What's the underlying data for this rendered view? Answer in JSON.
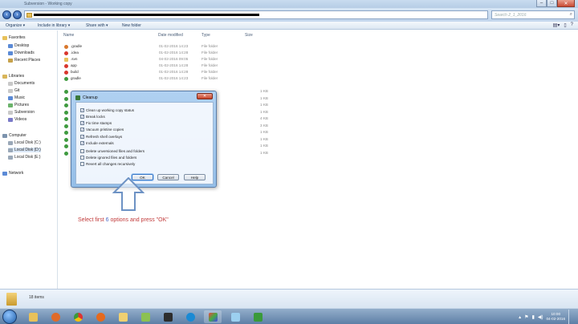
{
  "window": {
    "title": "Subversion - Working copy",
    "search_placeholder": "Search 2_1_2016"
  },
  "toolbar": {
    "organize": "Organize ▾",
    "include_library": "Include in library ▾",
    "share_with": "Share with ▾",
    "new_folder": "New folder"
  },
  "nav": {
    "favorites": "Favorites",
    "fav_items": [
      "Desktop",
      "Downloads",
      "Recent Places"
    ],
    "libraries": "Libraries",
    "lib_items": [
      "Documents",
      "Git",
      "Music",
      "Pictures",
      "Subversion",
      "Videos"
    ],
    "computer": "Computer",
    "drives": [
      "Local Disk (C:)",
      "Local Disk (D:)",
      "Local Disk (E:)"
    ],
    "network": "Network"
  },
  "columns": {
    "name": "Name",
    "date": "Date modified",
    "type": "Type",
    "size": "Size"
  },
  "files": [
    {
      "name": ".gradle",
      "date": "01-02-2016 14:23",
      "type": "File folder",
      "size": ""
    },
    {
      "name": ".idea",
      "date": "01-02-2016 14:28",
      "type": "File folder",
      "size": ""
    },
    {
      "name": ".svn",
      "date": "04-02-2016 09:05",
      "type": "File folder",
      "size": ""
    },
    {
      "name": "app",
      "date": "01-02-2016 14:28",
      "type": "File folder",
      "size": ""
    },
    {
      "name": "build",
      "date": "01-02-2016 14:28",
      "type": "File folder",
      "size": ""
    },
    {
      "name": "gradle",
      "date": "01-02-2016 14:23",
      "type": "File folder",
      "size": ""
    }
  ],
  "files_hidden_sizes": [
    "1 KB",
    "1 KB",
    "1 KB",
    "1 KB",
    "4 KB",
    "3 KB",
    "1 KB",
    "1 KB",
    "1 KB",
    "1 KB"
  ],
  "dialog": {
    "title": "Cleanup",
    "close": "✕",
    "options": [
      {
        "label": "Clean up working copy status",
        "checked": true
      },
      {
        "label": "Break locks",
        "checked": true
      },
      {
        "label": "Fix time stamps",
        "checked": true
      },
      {
        "label": "Vacuum pristine copies",
        "checked": true
      },
      {
        "label": "Refresh shell overlays",
        "checked": true
      },
      {
        "label": "Include externals",
        "checked": true
      },
      {
        "label": "Delete unversioned files and folders",
        "checked": false
      },
      {
        "label": "Delete ignored files and folders",
        "checked": false
      },
      {
        "label": "Revert all changes recursively",
        "checked": false
      }
    ],
    "ok": "OK",
    "cancel": "Cancel",
    "help": "Help"
  },
  "instruction": {
    "before": "Select first ",
    "number": "6",
    "after": " options and press \"OK\""
  },
  "status": {
    "items": "18 items"
  },
  "tray": {
    "time": "10:00",
    "date": "04-02-2016"
  },
  "colors": {
    "accent": "#3a78c8",
    "instruction_red": "#c13a3a"
  }
}
